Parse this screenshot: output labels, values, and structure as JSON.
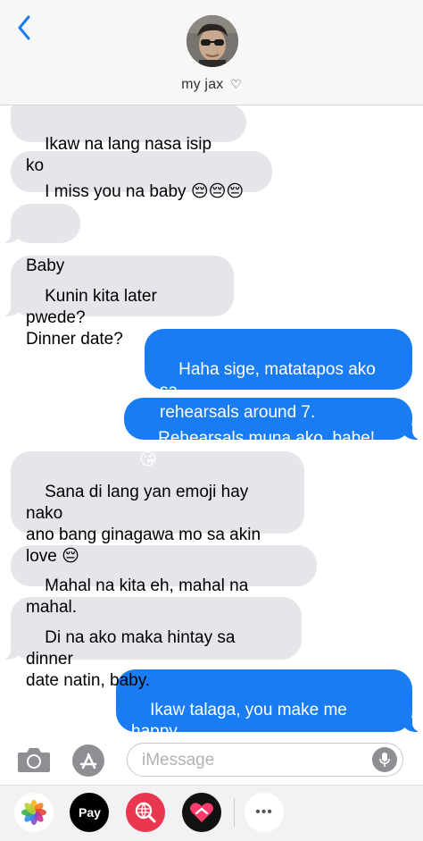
{
  "header": {
    "contact_name": "my jax",
    "heart": "♡",
    "back_icon": "chevron-left-icon"
  },
  "messages": [
    {
      "side": "received",
      "text": "Ikaw na lang nasa isip ko"
    },
    {
      "side": "received",
      "text": "I miss you na baby 😔😔😔"
    },
    {
      "side": "received",
      "text": "Baby"
    },
    {
      "side": "received",
      "text": "Kunin kita later pwede?\nDinner date?"
    },
    {
      "side": "sent",
      "text": "Haha sige, matatapos ako sa\nrehearsals around 7."
    },
    {
      "side": "sent",
      "text": "Rehearsals muna ako, babe! 😘"
    },
    {
      "side": "received",
      "text": "Sana di lang yan emoji hay nako\nano bang ginagawa mo sa akin\nlove 😔"
    },
    {
      "side": "received",
      "text": "Mahal na kita eh, mahal na mahal."
    },
    {
      "side": "received",
      "text": "Di na ako maka hintay sa dinner\ndate natin, baby."
    },
    {
      "side": "sent",
      "text": "Ikaw talaga, you make me happy\neveryday. ❤️"
    }
  ],
  "input": {
    "placeholder": "iMessage"
  },
  "drawer": {
    "applepay_label": "Pay",
    "apple_glyph": "",
    "more_glyph": "•••"
  },
  "colors": {
    "sent_bubble": "#1a7cf2",
    "received_bubble": "#e5e5ea",
    "accent": "#1a7cf2"
  }
}
